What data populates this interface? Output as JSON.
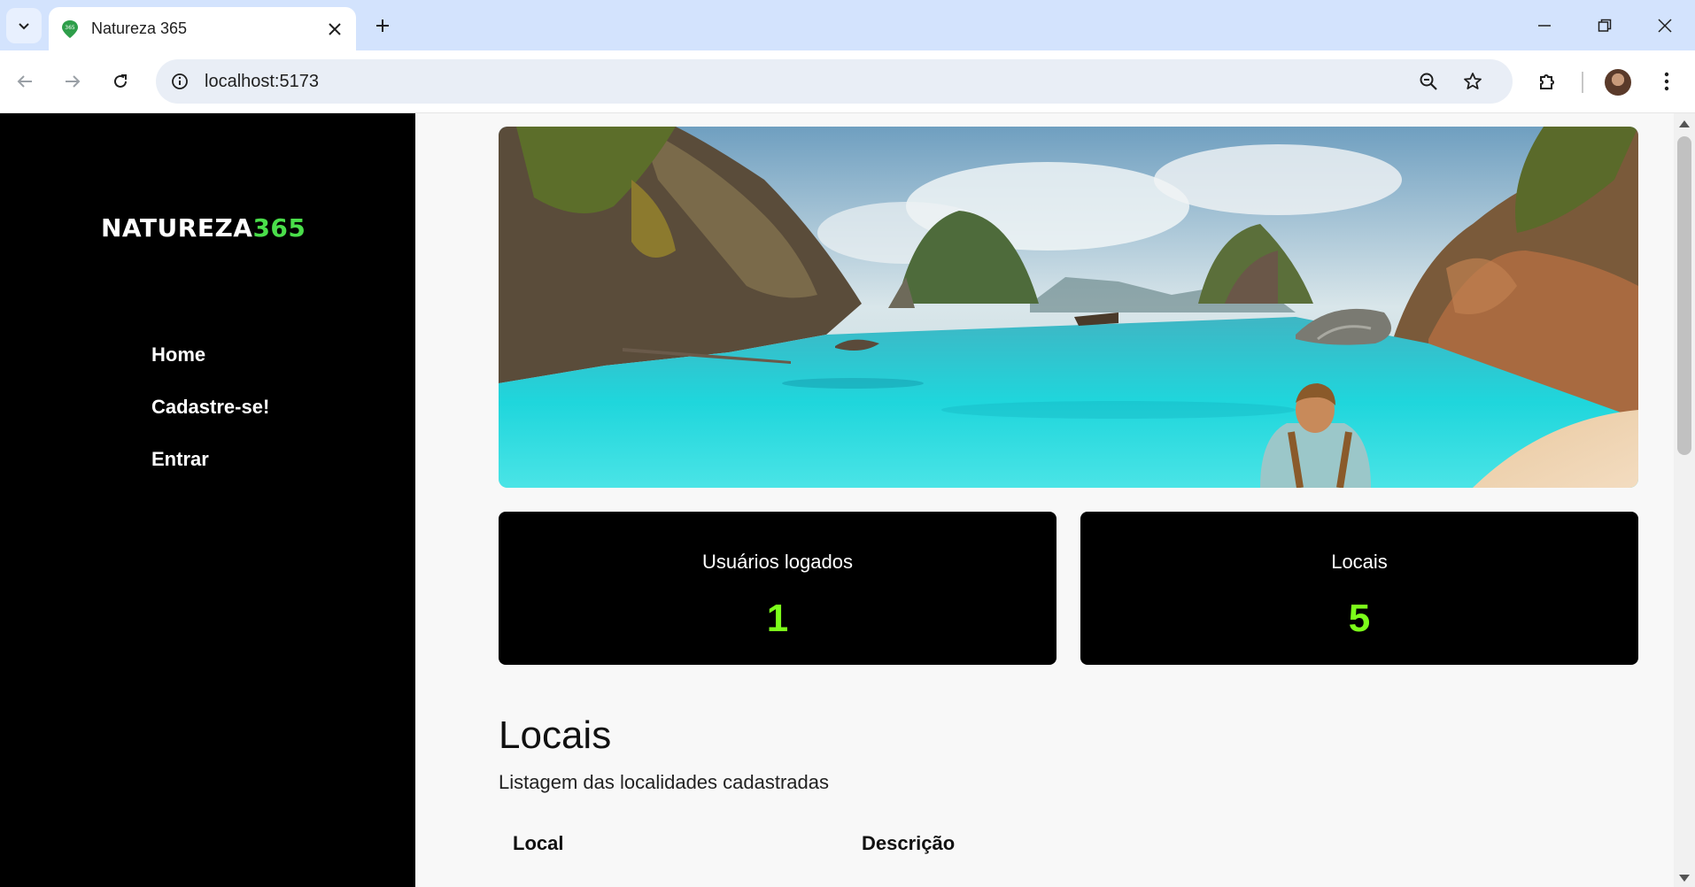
{
  "browser": {
    "tab_title": "Natureza 365",
    "url": "localhost:5173",
    "favicon_text": "365"
  },
  "sidebar": {
    "logo_main": "NATUREZA",
    "logo_accent": "365",
    "items": [
      {
        "label": "Home"
      },
      {
        "label": "Cadastre-se!"
      },
      {
        "label": "Entrar"
      }
    ]
  },
  "stats": [
    {
      "label": "Usuários logados",
      "value": "1"
    },
    {
      "label": "Locais",
      "value": "5"
    }
  ],
  "locais": {
    "title": "Locais",
    "subtitle": "Listagem das localidades cadastradas",
    "columns": [
      "Local",
      "Descrição"
    ]
  },
  "colors": {
    "sidebar_bg": "#000000",
    "logo_accent": "#4ade4a",
    "stat_value": "#7cff1a"
  }
}
